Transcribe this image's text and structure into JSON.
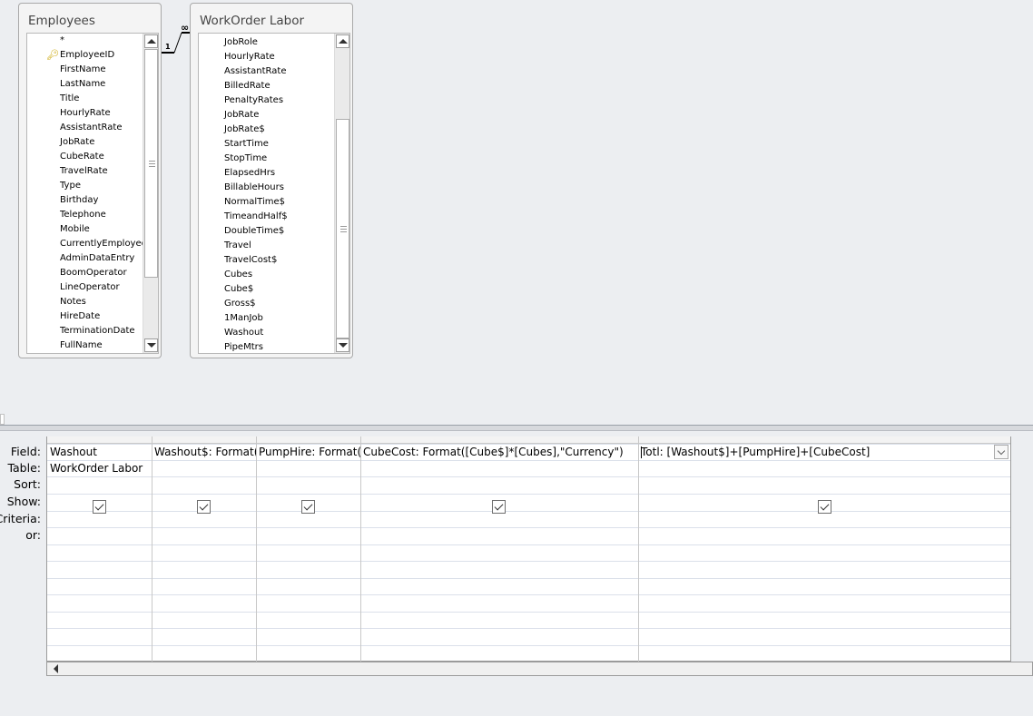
{
  "tables": [
    {
      "title": "Employees",
      "fields": [
        "*",
        "EmployeeID",
        "FirstName",
        "LastName",
        "Title",
        "HourlyRate",
        "AssistantRate",
        "JobRate",
        "CubeRate",
        "TravelRate",
        "Type",
        "Birthday",
        "Telephone",
        "Mobile",
        "CurrentlyEmployed",
        "AdminDataEntry",
        "BoomOperator",
        "LineOperator",
        "Notes",
        "HireDate",
        "TerminationDate",
        "FullName"
      ],
      "primary_key": "EmployeeID"
    },
    {
      "title": "WorkOrder Labor",
      "fields": [
        "JobRole",
        "HourlyRate",
        "AssistantRate",
        "BilledRate",
        "PenaltyRates",
        "JobRate",
        "JobRate$",
        "StartTime",
        "StopTime",
        "ElapsedHrs",
        "BillableHours",
        "NormalTime$",
        "TimeandHalf$",
        "DoubleTime$",
        "Travel",
        "TravelCost$",
        "Cubes",
        "Cube$",
        "Gross$",
        "1ManJob",
        "Washout",
        "PipeMtrs"
      ]
    }
  ],
  "relationship": {
    "one_side": "1",
    "many_side": "∞",
    "from": "Employees",
    "to": "WorkOrder Labor"
  },
  "design_grid": {
    "row_labels": [
      "Field:",
      "Table:",
      "Sort:",
      "Show:",
      "Criteria:",
      "or:"
    ],
    "columns": [
      {
        "field": "Washout",
        "table": "WorkOrder Labor",
        "sort": "",
        "show": true
      },
      {
        "field": "Washout$: Format([Washout],\"Currency\")",
        "table": "",
        "sort": "",
        "show": true
      },
      {
        "field": "PumpHire: Format([PumpHire],\"Currency\")",
        "table": "",
        "sort": "",
        "show": true
      },
      {
        "field": "CubeCost: Format([Cube$]*[Cubes],\"Currency\")",
        "table": "",
        "sort": "",
        "show": true
      },
      {
        "field": "Totl: [Washout$]+[PumpHire]+[CubeCost]",
        "table": "",
        "sort": "",
        "show": true,
        "active": true
      }
    ]
  },
  "icons": {
    "primary_key": "key-icon",
    "scroll_up": "triangle-up-icon",
    "scroll_down": "triangle-down-icon",
    "scroll_left": "triangle-left-icon",
    "dropdown": "chevron-down-icon"
  }
}
